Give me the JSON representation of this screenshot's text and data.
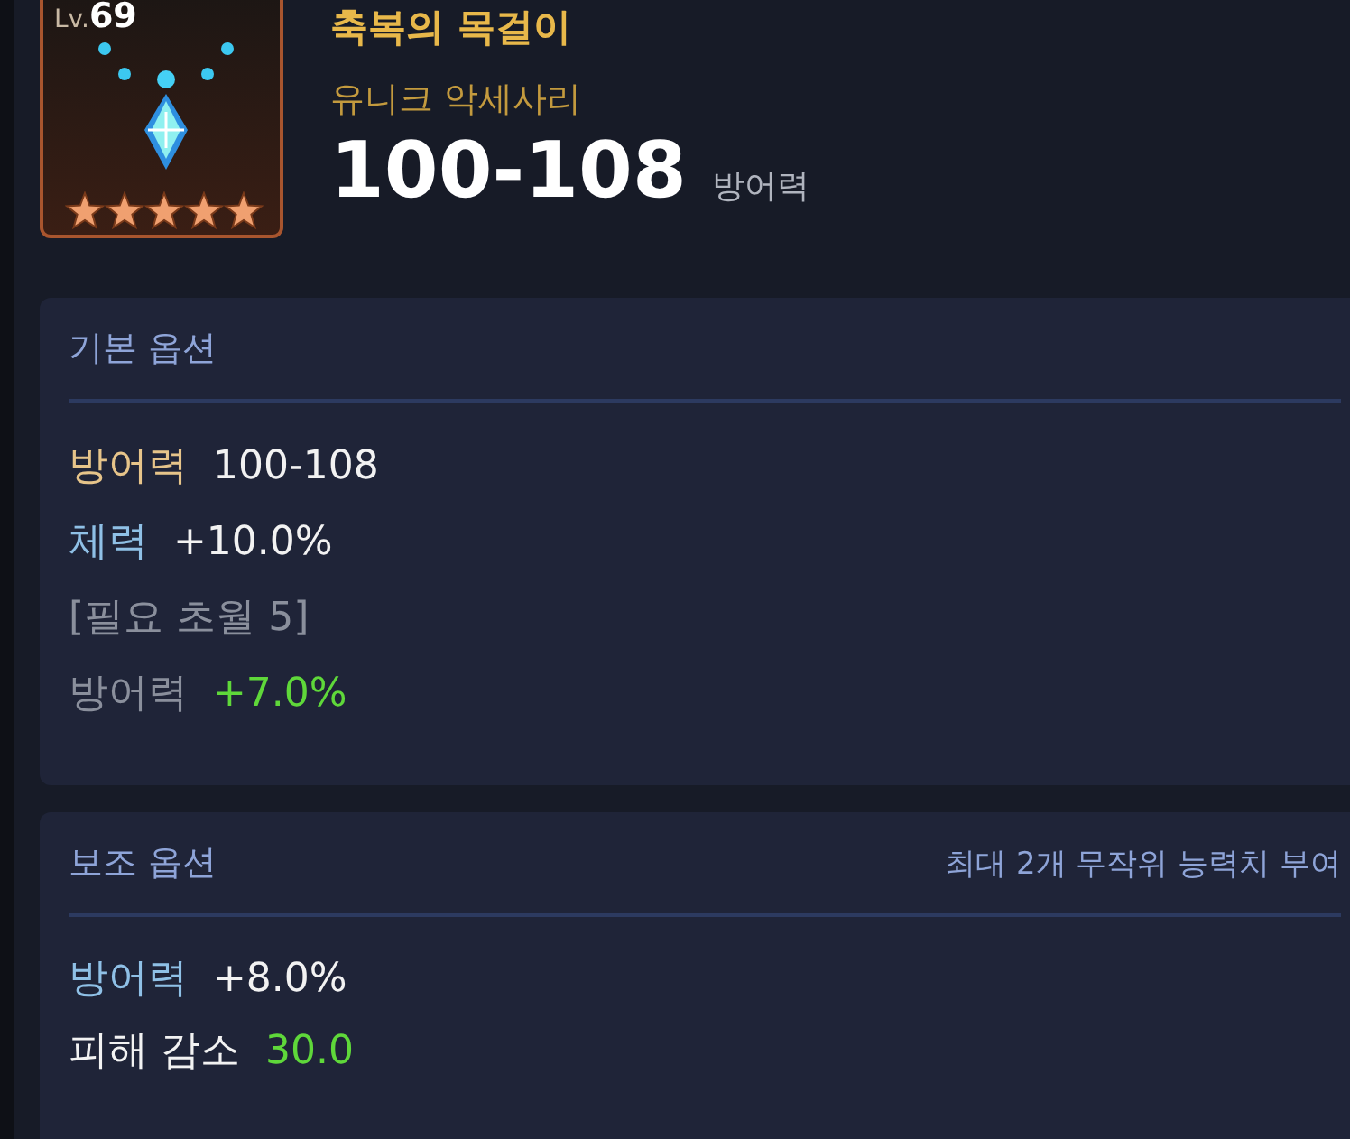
{
  "item": {
    "lv_label": "Lv.",
    "lv_value": "69",
    "stars": 5,
    "name": "축복의 목걸이",
    "type": "유니크 악세사리",
    "stat_value": "100-108",
    "stat_name": "방어력"
  },
  "panels": [
    {
      "title": "기본 옵션",
      "lines": [
        {
          "kind": "stat",
          "label": {
            "text": "방어력",
            "color": "#e6c48a"
          },
          "value": {
            "text": "100-108",
            "color": "#f2f2f2"
          }
        },
        {
          "kind": "stat",
          "label": {
            "text": "체력",
            "color": "#8fc0e6"
          },
          "value": {
            "text": "+10.0%",
            "color": "#f2f2f2"
          }
        },
        {
          "kind": "note",
          "text": "[필요 초월 5]"
        },
        {
          "kind": "stat",
          "label": {
            "text": "방어력",
            "color": "#8a8f9c"
          },
          "value": {
            "text": "+7.0%",
            "color": "#5fd83a"
          }
        }
      ]
    },
    {
      "title": "보조 옵션",
      "note": "최대 2개 무작위 능력치 부여",
      "lines": [
        {
          "kind": "stat",
          "label": {
            "text": "방어력",
            "color": "#8fc0e6"
          },
          "value": {
            "text": "+8.0%",
            "color": "#f2f2f2"
          }
        },
        {
          "kind": "stat",
          "label": {
            "text": "피해 감소",
            "color": "#f2f2f2"
          },
          "value": {
            "text": "30.0",
            "color": "#5fd83a"
          }
        }
      ]
    }
  ]
}
